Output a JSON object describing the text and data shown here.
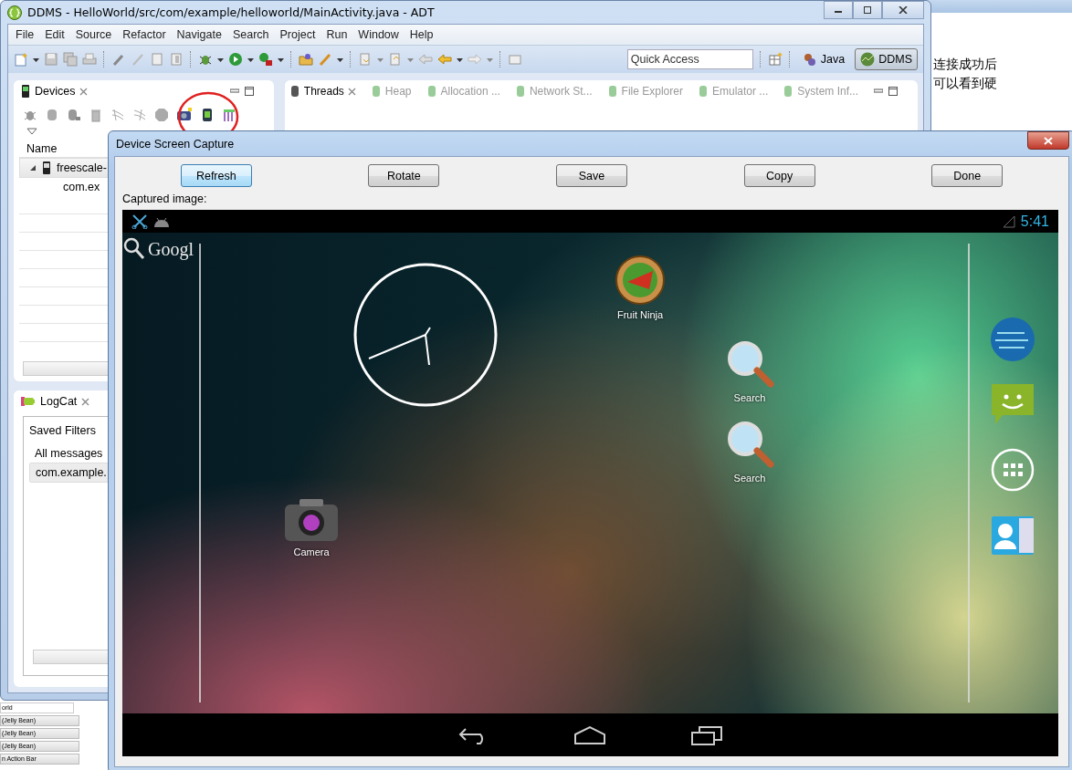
{
  "adt_window": {
    "title": "DDMS - HelloWorld/src/com/example/helloworld/MainActivity.java - ADT",
    "menu": [
      "File",
      "Edit",
      "Source",
      "Refactor",
      "Navigate",
      "Search",
      "Project",
      "Run",
      "Window",
      "Help"
    ],
    "quick_access": {
      "placeholder": "Quick Access"
    },
    "perspectives": [
      {
        "label": "Java",
        "selected": false
      },
      {
        "label": "DDMS",
        "selected": true
      }
    ],
    "devices_panel": {
      "tab": "Devices",
      "column": "Name",
      "rows": [
        {
          "label": "freescale-",
          "expanded": true,
          "children": [
            {
              "label": "com.ex"
            }
          ]
        }
      ]
    },
    "logcat_panel": {
      "tab": "LogCat",
      "heading": "Saved Filters",
      "filters": [
        {
          "label": "All messages",
          "selected": false
        },
        {
          "label": "com.example.",
          "selected": true
        }
      ]
    },
    "view_tabs": [
      {
        "label": "Threads",
        "selected": true
      },
      {
        "label": "Heap",
        "selected": false
      },
      {
        "label": "Allocation ...",
        "selected": false
      },
      {
        "label": "Network St...",
        "selected": false
      },
      {
        "label": "File Explorer",
        "selected": false
      },
      {
        "label": "Emulator ...",
        "selected": false
      },
      {
        "label": "System Inf...",
        "selected": false
      }
    ]
  },
  "dialog": {
    "title": "Device Screen Capture",
    "buttons": [
      {
        "label": "Refresh",
        "focused": true
      },
      {
        "label": "Rotate",
        "focused": false
      },
      {
        "label": "Save",
        "focused": false
      },
      {
        "label": "Copy",
        "focused": false
      },
      {
        "label": "Done",
        "focused": false
      }
    ],
    "caption": "Captured image:",
    "device_screen": {
      "time": "5:41",
      "search_label": "Googl",
      "apps": [
        {
          "label": "Fruit Ninja",
          "kind": "fruit"
        },
        {
          "label": "Search",
          "kind": "search"
        },
        {
          "label": "Search",
          "kind": "search"
        },
        {
          "label": "Camera",
          "kind": "camera"
        }
      ]
    }
  },
  "background_notes": [
    "连接成功后",
    "可以看到硬"
  ],
  "background_form": {
    "field_value": "orld",
    "dropdowns": [
      "(Jelly Bean)",
      "(Jelly Bean)",
      "(Jelly Bean)",
      "n Action Bar"
    ]
  }
}
